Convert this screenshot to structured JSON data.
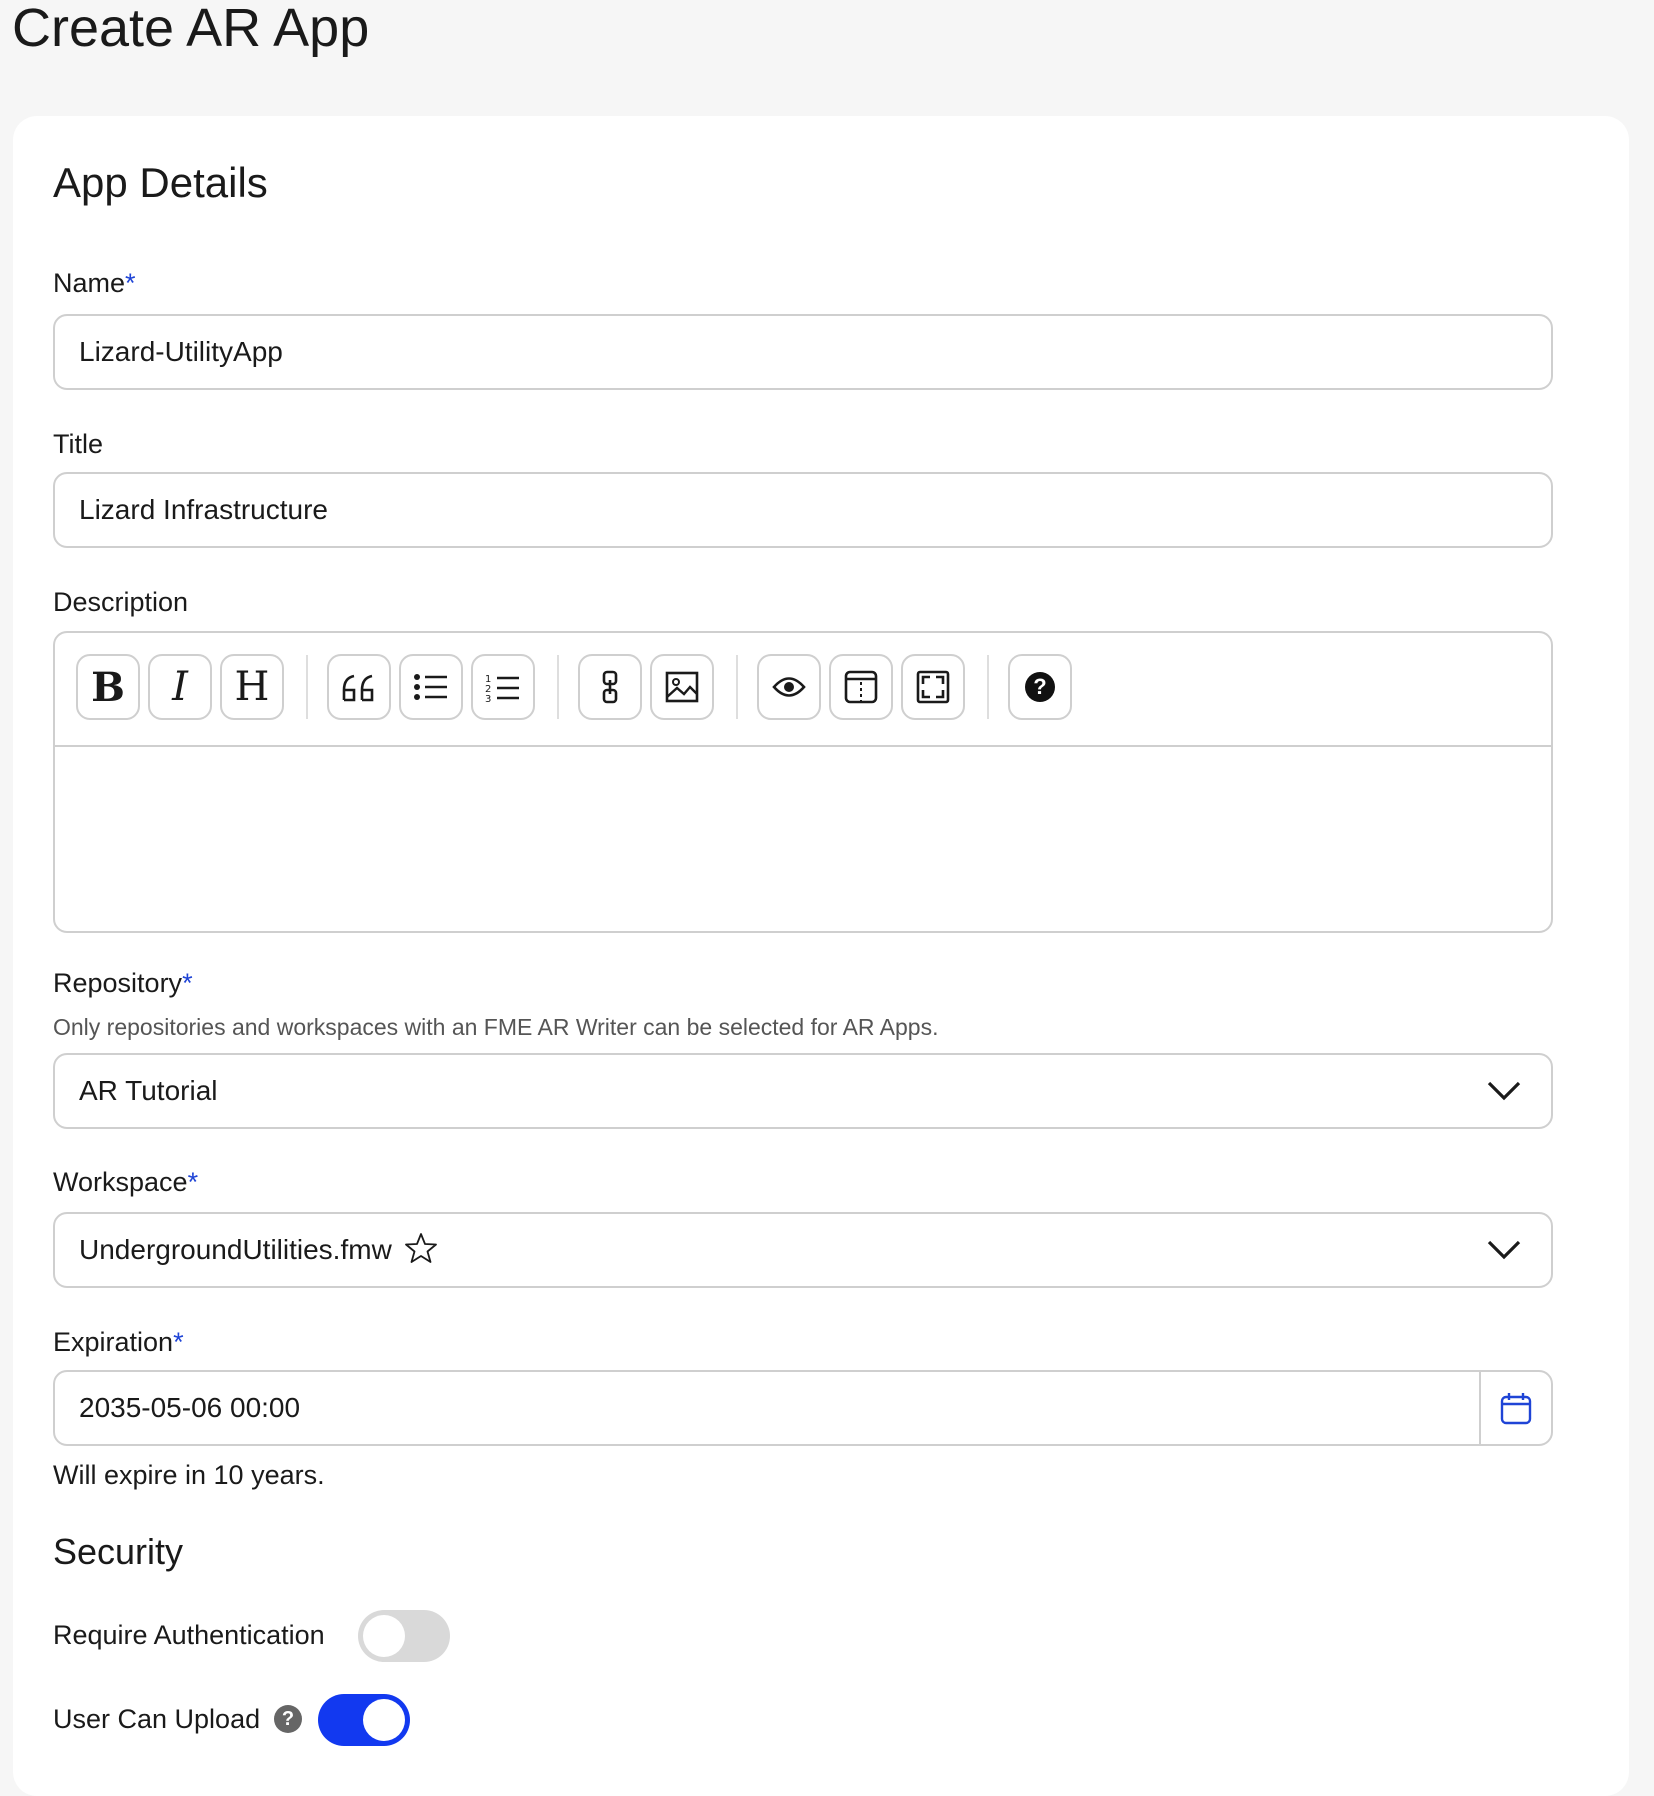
{
  "page": {
    "title": "Create AR App"
  },
  "app_details": {
    "heading": "App Details",
    "name": {
      "label": "Name",
      "required_mark": "*",
      "value": "Lizard-UtilityApp"
    },
    "title": {
      "label": "Title",
      "value": "Lizard Infrastructure"
    },
    "description": {
      "label": "Description",
      "value": "",
      "toolbar": {
        "bold": "B",
        "italic": "I",
        "heading": "H",
        "quote_icon": "quote-icon",
        "unordered_list_icon": "unordered-list-icon",
        "ordered_list_icon": "ordered-list-icon",
        "link_icon": "link-icon",
        "image_icon": "image-icon",
        "preview_icon": "eye-icon",
        "side_by_side_icon": "side-by-side-icon",
        "fullscreen_icon": "fullscreen-icon",
        "guide_icon": "help-icon",
        "guide_glyph": "?"
      }
    },
    "repository": {
      "label": "Repository",
      "required_mark": "*",
      "helper": "Only repositories and workspaces with an FME AR Writer can be selected for AR Apps.",
      "value": "AR Tutorial"
    },
    "workspace": {
      "label": "Workspace",
      "required_mark": "*",
      "value": "UndergroundUtilities.fmw"
    },
    "expiration": {
      "label": "Expiration",
      "required_mark": "*",
      "value": "2035-05-06 00:00",
      "note": "Will expire in 10 years."
    }
  },
  "security": {
    "heading": "Security",
    "require_auth": {
      "label": "Require Authentication",
      "enabled": false
    },
    "user_can_upload": {
      "label": "User Can Upload",
      "help_glyph": "?",
      "enabled": true
    }
  },
  "colors": {
    "accent": "#1239f0",
    "required": "#1f44d6",
    "toggle_off": "#d9d9d9"
  }
}
